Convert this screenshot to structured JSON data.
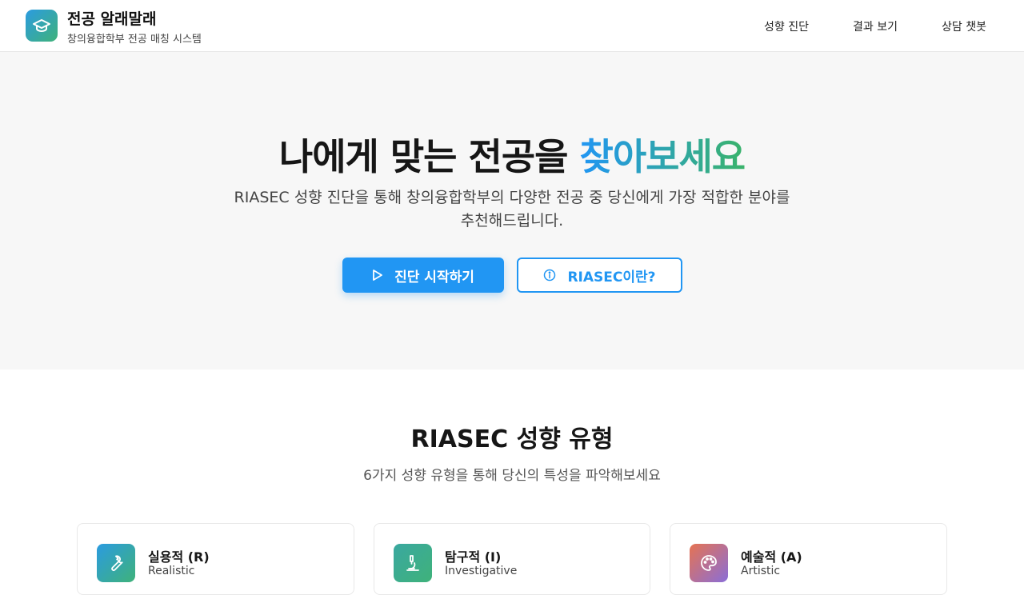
{
  "header": {
    "title": "전공 알래말래",
    "subtitle": "창의융합학부 전공 매칭 시스템",
    "logo_icon": "graduation-cap-icon",
    "nav": [
      {
        "label": "성향 진단"
      },
      {
        "label": "결과 보기"
      },
      {
        "label": "상담 챗봇"
      }
    ]
  },
  "hero": {
    "title_plain": "나에게 맞는 전공을 ",
    "title_highlight": "찾아보세요",
    "description": "RIASEC 성향 진단을 통해 창의융합학부의 다양한 전공 중 당신에게 가장 적합한 분야를 추천해드립니다.",
    "primary_button": {
      "label": "진단 시작하기",
      "icon": "play-icon"
    },
    "secondary_button": {
      "label": "RIASEC이란?",
      "icon": "info-icon"
    }
  },
  "riasec": {
    "title": "RIASEC 성향 유형",
    "subtitle": "6가지 성향 유형을 통해 당신의 특성을 파악해보세요",
    "cards": [
      {
        "title": "실용적 (R)",
        "subtitle": "Realistic",
        "icon": "wrench-icon"
      },
      {
        "title": "탐구적 (I)",
        "subtitle": "Investigative",
        "icon": "microscope-icon"
      },
      {
        "title": "예술적 (A)",
        "subtitle": "Artistic",
        "icon": "palette-icon"
      }
    ]
  },
  "colors": {
    "primary": "#2196f3",
    "accent_green": "#3ab36b",
    "hero_bg": "#f7f7f7"
  }
}
